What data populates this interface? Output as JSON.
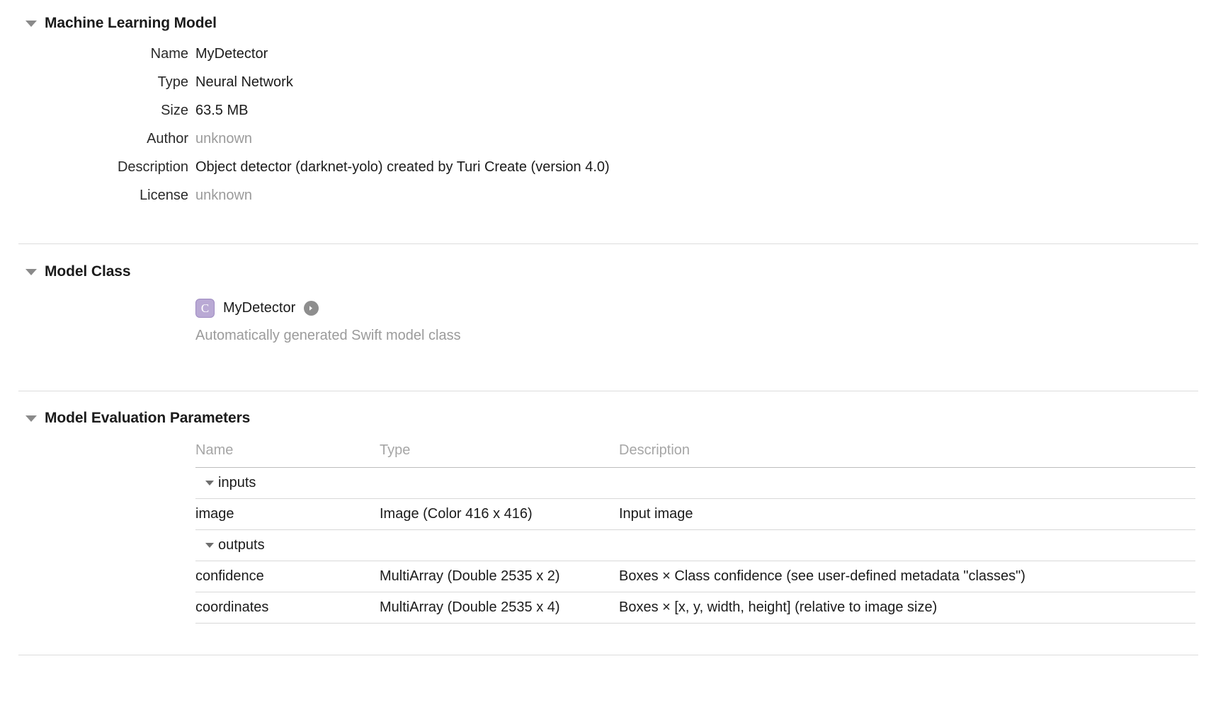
{
  "sections": {
    "ml_model": {
      "title": "Machine Learning Model",
      "rows": [
        {
          "label": "Name",
          "value": "MyDetector",
          "dim": false
        },
        {
          "label": "Type",
          "value": "Neural Network",
          "dim": false
        },
        {
          "label": "Size",
          "value": "63.5 MB",
          "dim": false
        },
        {
          "label": "Author",
          "value": "unknown",
          "dim": true
        },
        {
          "label": "Description",
          "value": "Object detector (darknet-yolo) created by Turi Create (version 4.0)",
          "dim": false
        },
        {
          "label": "License",
          "value": "unknown",
          "dim": true
        }
      ]
    },
    "model_class": {
      "title": "Model Class",
      "badge_letter": "C",
      "class_name": "MyDetector",
      "subtitle": "Automatically generated Swift model class"
    },
    "eval_params": {
      "title": "Model Evaluation Parameters",
      "columns": {
        "name": "Name",
        "type": "Type",
        "description": "Description"
      },
      "groups": [
        {
          "label": "inputs",
          "rows": [
            {
              "name": "image",
              "type": "Image (Color 416 x 416)",
              "description": "Input image"
            }
          ]
        },
        {
          "label": "outputs",
          "rows": [
            {
              "name": "confidence",
              "type": "MultiArray (Double 2535 x 2)",
              "description": "Boxes × Class confidence (see user-defined metadata \"classes\")"
            },
            {
              "name": "coordinates",
              "type": "MultiArray (Double 2535 x 4)",
              "description": "Boxes × [x, y, width, height] (relative to image size)"
            }
          ]
        }
      ]
    }
  },
  "colors": {
    "badge_fill": "#b9a9d4",
    "badge_border": "#9f8cc2",
    "arrow_button": "#8e8e8e",
    "dim_text": "#9b9b9b",
    "header_text": "#a6a6a6",
    "rule": "#dcdcdc"
  }
}
